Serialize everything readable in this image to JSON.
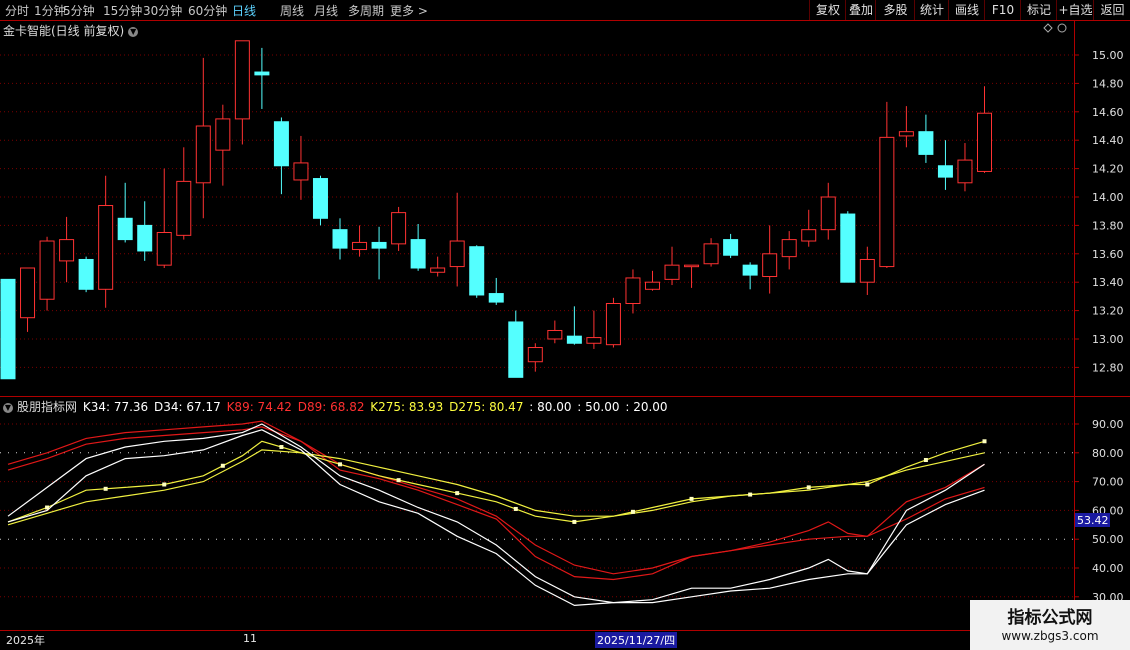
{
  "toolbar": {
    "periods": [
      "分时",
      "1分钟",
      "5分钟",
      "15分钟",
      "30分钟",
      "60分钟",
      "日线",
      "周线",
      "月线",
      "多周期",
      "更多 >"
    ],
    "active_period": "日线",
    "right_buttons": [
      "复权",
      "叠加",
      "多股",
      "统计",
      "画线",
      "F10",
      "标记",
      "+自选",
      "返回"
    ]
  },
  "main_chart": {
    "title": "金卡智能(日线 前复权)",
    "price_ticks": [
      "15.00",
      "14.80",
      "14.60",
      "14.40",
      "14.20",
      "14.00",
      "13.80",
      "13.60",
      "13.40",
      "13.20",
      "13.00",
      "12.80"
    ],
    "colors": {
      "up": "#ff3232",
      "down": "#54ffff",
      "grid": "#7a0000",
      "border": "#b00000"
    }
  },
  "indicator": {
    "name": "股朋指标网",
    "labels": [
      {
        "text": "K34: 77.36",
        "color": "#ffffff"
      },
      {
        "text": "D34: 67.17",
        "color": "#ffffff"
      },
      {
        "text": "K89: 74.42",
        "color": "#ff3030"
      },
      {
        "text": "D89: 68.82",
        "color": "#ff3030"
      },
      {
        "text": "K275: 83.93",
        "color": "#ffff40"
      },
      {
        "text": "D275: 80.47",
        "color": "#ffff40"
      },
      {
        "text": ": 80.00",
        "color": "#ffffff"
      },
      {
        "text": ": 50.00",
        "color": "#ffffff"
      },
      {
        "text": ": 20.00",
        "color": "#ffffff"
      }
    ],
    "ticks": [
      "90.00",
      "80.00",
      "70.00",
      "60.00",
      "50.00",
      "40.00",
      "30.00"
    ],
    "current_value": "53.42"
  },
  "dates": {
    "year_label": "2025年",
    "month_label": "11",
    "cursor_date": "2025/11/27/四"
  },
  "watermark": {
    "title": "指标公式网",
    "url": "www.zbgs3.com"
  },
  "chart_data": {
    "type": "candlestick",
    "candles": [
      {
        "o": 13.42,
        "c": 12.72,
        "h": 13.42,
        "l": 12.72
      },
      {
        "o": 13.15,
        "c": 13.5,
        "h": 13.5,
        "l": 13.05
      },
      {
        "o": 13.28,
        "c": 13.69,
        "h": 13.72,
        "l": 13.2
      },
      {
        "o": 13.55,
        "c": 13.7,
        "h": 13.86,
        "l": 13.4
      },
      {
        "o": 13.56,
        "c": 13.35,
        "h": 13.58,
        "l": 13.33
      },
      {
        "o": 13.35,
        "c": 13.94,
        "h": 14.15,
        "l": 13.22
      },
      {
        "o": 13.85,
        "c": 13.7,
        "h": 14.1,
        "l": 13.68
      },
      {
        "o": 13.8,
        "c": 13.62,
        "h": 13.97,
        "l": 13.55
      },
      {
        "o": 13.52,
        "c": 13.75,
        "h": 14.2,
        "l": 13.5
      },
      {
        "o": 13.73,
        "c": 14.11,
        "h": 14.35,
        "l": 13.7
      },
      {
        "o": 14.1,
        "c": 14.5,
        "h": 14.98,
        "l": 13.85
      },
      {
        "o": 14.33,
        "c": 14.55,
        "h": 14.65,
        "l": 14.08
      },
      {
        "o": 14.55,
        "c": 15.1,
        "h": 15.1,
        "l": 14.37
      },
      {
        "o": 14.88,
        "c": 14.86,
        "h": 15.05,
        "l": 14.62
      },
      {
        "o": 14.53,
        "c": 14.22,
        "h": 14.56,
        "l": 14.02
      },
      {
        "o": 14.12,
        "c": 14.24,
        "h": 14.43,
        "l": 13.98
      },
      {
        "o": 14.13,
        "c": 13.85,
        "h": 14.15,
        "l": 13.8
      },
      {
        "o": 13.77,
        "c": 13.64,
        "h": 13.85,
        "l": 13.56
      },
      {
        "o": 13.63,
        "c": 13.68,
        "h": 13.8,
        "l": 13.58
      },
      {
        "o": 13.68,
        "c": 13.64,
        "h": 13.79,
        "l": 13.42
      },
      {
        "o": 13.67,
        "c": 13.89,
        "h": 13.93,
        "l": 13.62
      },
      {
        "o": 13.7,
        "c": 13.5,
        "h": 13.81,
        "l": 13.48
      },
      {
        "o": 13.47,
        "c": 13.5,
        "h": 13.58,
        "l": 13.44
      },
      {
        "o": 13.51,
        "c": 13.69,
        "h": 14.03,
        "l": 13.37
      },
      {
        "o": 13.65,
        "c": 13.31,
        "h": 13.66,
        "l": 13.29
      },
      {
        "o": 13.32,
        "c": 13.26,
        "h": 13.43,
        "l": 13.24
      },
      {
        "o": 13.12,
        "c": 12.73,
        "h": 13.2,
        "l": 12.73
      },
      {
        "o": 12.84,
        "c": 12.94,
        "h": 12.97,
        "l": 12.77
      },
      {
        "o": 13.0,
        "c": 13.06,
        "h": 13.13,
        "l": 12.97
      },
      {
        "o": 13.02,
        "c": 12.97,
        "h": 13.23,
        "l": 12.96
      },
      {
        "o": 12.97,
        "c": 13.01,
        "h": 13.2,
        "l": 12.93
      },
      {
        "o": 12.96,
        "c": 13.25,
        "h": 13.29,
        "l": 12.94
      },
      {
        "o": 13.25,
        "c": 13.43,
        "h": 13.49,
        "l": 13.18
      },
      {
        "o": 13.35,
        "c": 13.4,
        "h": 13.48,
        "l": 13.34
      },
      {
        "o": 13.42,
        "c": 13.52,
        "h": 13.65,
        "l": 13.38
      },
      {
        "o": 13.52,
        "c": 13.52,
        "h": 13.52,
        "l": 13.36
      },
      {
        "o": 13.53,
        "c": 13.67,
        "h": 13.71,
        "l": 13.51
      },
      {
        "o": 13.7,
        "c": 13.59,
        "h": 13.74,
        "l": 13.57
      },
      {
        "o": 13.52,
        "c": 13.45,
        "h": 13.54,
        "l": 13.35
      },
      {
        "o": 13.44,
        "c": 13.6,
        "h": 13.8,
        "l": 13.32
      },
      {
        "o": 13.58,
        "c": 13.7,
        "h": 13.76,
        "l": 13.49
      },
      {
        "o": 13.69,
        "c": 13.77,
        "h": 13.91,
        "l": 13.65
      },
      {
        "o": 13.77,
        "c": 14.0,
        "h": 14.1,
        "l": 13.7
      },
      {
        "o": 13.88,
        "c": 13.4,
        "h": 13.9,
        "l": 13.4
      },
      {
        "o": 13.4,
        "c": 13.56,
        "h": 13.65,
        "l": 13.31
      },
      {
        "o": 13.51,
        "c": 14.42,
        "h": 14.67,
        "l": 13.5
      },
      {
        "o": 14.43,
        "c": 14.46,
        "h": 14.64,
        "l": 14.35
      },
      {
        "o": 14.46,
        "c": 14.3,
        "h": 14.58,
        "l": 14.24
      },
      {
        "o": 14.22,
        "c": 14.14,
        "h": 14.4,
        "l": 14.05
      },
      {
        "o": 14.1,
        "c": 14.26,
        "h": 14.38,
        "l": 14.04
      },
      {
        "o": 14.18,
        "c": 14.59,
        "h": 14.78,
        "l": 14.17
      }
    ]
  }
}
